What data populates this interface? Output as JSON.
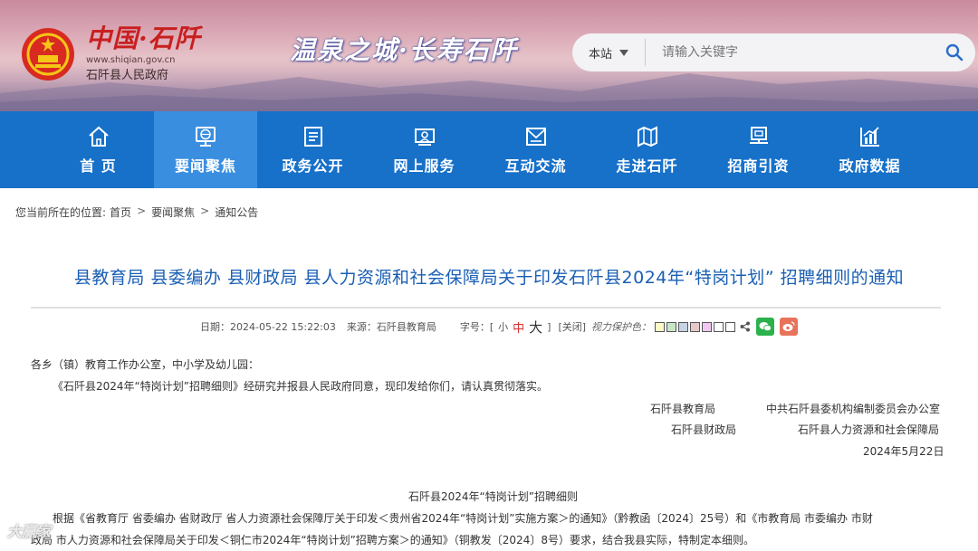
{
  "header": {
    "logo_text": "中国·石阡",
    "logo_url": "www.shiqian.gov.cn",
    "gov_name": "石阡县人民政府",
    "slogan": "温泉之城·长寿石阡"
  },
  "search": {
    "scope": "本站",
    "placeholder": "请输入关键字"
  },
  "nav": [
    {
      "label": "首  页",
      "icon": "home-icon"
    },
    {
      "label": "要闻聚焦",
      "icon": "globe-monitor-icon"
    },
    {
      "label": "政务公开",
      "icon": "document-list-icon"
    },
    {
      "label": "网上服务",
      "icon": "service-screen-icon"
    },
    {
      "label": "互动交流",
      "icon": "mail-icon"
    },
    {
      "label": "走进石阡",
      "icon": "map-icon"
    },
    {
      "label": "招商引资",
      "icon": "presentation-icon"
    },
    {
      "label": "政府数据",
      "icon": "bar-chart-icon"
    }
  ],
  "breadcrumb": {
    "prefix": "您当前所在的位置:",
    "items": [
      "首页",
      "要闻聚焦",
      "通知公告"
    ]
  },
  "article": {
    "title": "县教育局 县委编办 县财政局 县人力资源和社会保障局关于印发石阡县2024年“特岗计划” 招聘细则的通知",
    "date": "日期：2024-05-22 15:22:03",
    "source": "来源：石阡县教育局",
    "font_label": "字号：[",
    "font_small": "小",
    "font_medium": "中",
    "font_large": "大",
    "font_close": "]",
    "close": "[关闭]",
    "vision_label": "视力保护色：",
    "vision_colors": [
      "#fafac8",
      "#c8e6c8",
      "#c8d2e6",
      "#e6c8c8",
      "#f0c8f0",
      "#ffffff",
      "#ffffff"
    ],
    "salutation": "各乡（镇）教育工作办公室，中小学及幼儿园：",
    "body1": "《石阡县2024年“特岗计划”招聘细则》经研究并报县人民政府同意，现印发给你们，请认真贯彻落实。",
    "sign_left_1": "石阡县教育局",
    "sign_right_1": "中共石阡县委机构编制委员会办公室",
    "sign_left_2": "石阡县财政局",
    "sign_right_2": "石阡县人力资源和社会保障局",
    "sign_date": "2024年5月22日",
    "sub_title": "石阡县2024年“特岗计划”招聘细则",
    "body2_line1": "根据《省教育厅  省委编办  省财政厅  省人力资源社会保障厅关于印发＜贵州省2024年“特岗计划”实施方案＞的通知》（黔教函〔2024〕25号）和《市教育局  市委编办  市财",
    "body2_line2": "政局  市人力资源和社会保障局关于印发＜铜仁市2024年“特岗计划”招聘方案＞的通知》（铜教发〔2024〕8号）要求，结合我县实际，特制定本细则。"
  },
  "watermark": "大赢家"
}
